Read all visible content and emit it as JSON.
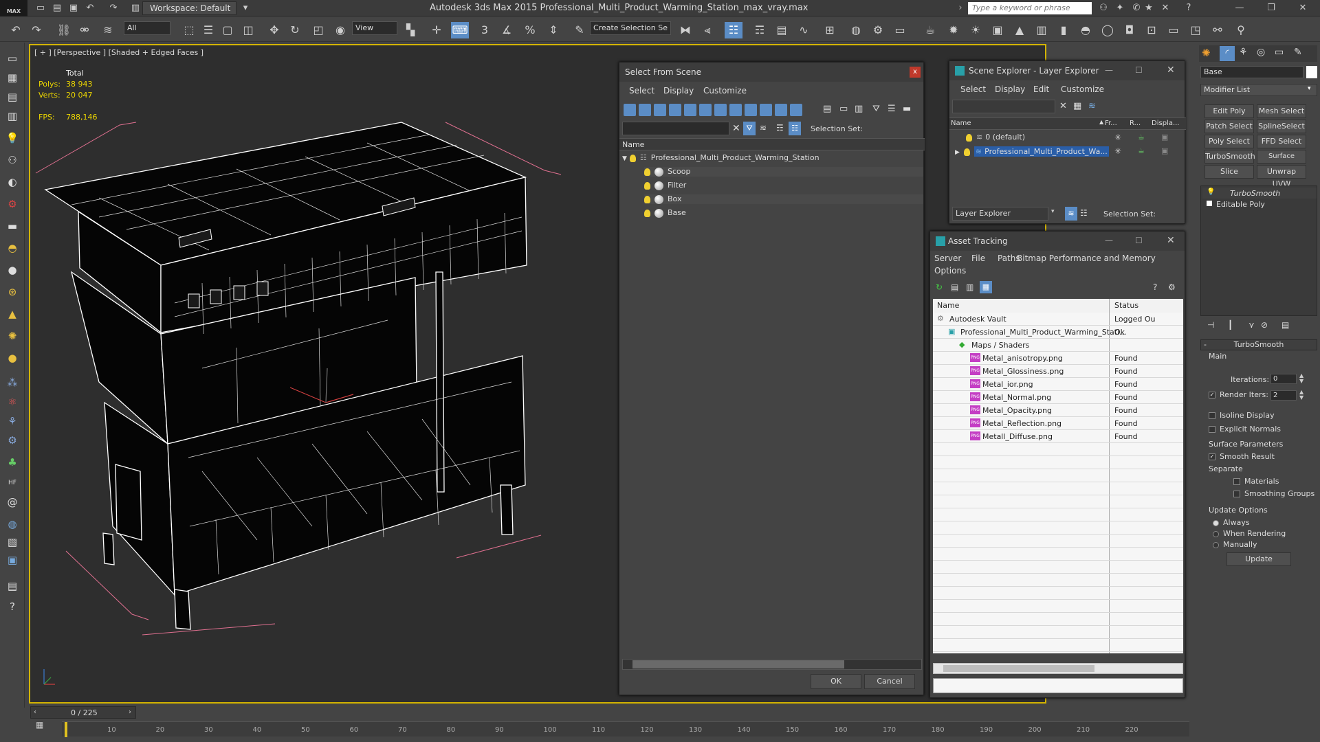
{
  "window": {
    "title": "Autodesk 3ds Max  2015     Professional_Multi_Product_Warming_Station_max_vray.max",
    "logo": "MAX",
    "workspace": "Workspace: Default",
    "search_placeholder": "Type a keyword or phrase"
  },
  "toolbar": {
    "filter_select": "All",
    "refcoord_select": "View",
    "selection_set": "Create Selection Se"
  },
  "viewport": {
    "label": "[ + ] [Perspective ] [Shaded + Edged Faces ]",
    "stats": {
      "total_label": "Total",
      "polys_label": "Polys:",
      "polys_value": "38 943",
      "verts_label": "Verts:",
      "verts_value": "20 047",
      "fps_label": "FPS:",
      "fps_value": "788,146"
    }
  },
  "select_from_scene": {
    "title": "Select From Scene",
    "close": "x",
    "menu": [
      "Select",
      "Display",
      "Customize"
    ],
    "selection_set_label": "Selection Set:",
    "column_name": "Name",
    "root": "Professional_Multi_Product_Warming_Station",
    "children": [
      "Scoop",
      "Filter",
      "Box",
      "Base"
    ],
    "ok": "OK",
    "cancel": "Cancel"
  },
  "scene_explorer": {
    "title": "Scene Explorer - Layer Explorer",
    "menu": [
      "Select",
      "Display",
      "Edit",
      "Customize"
    ],
    "columns": [
      "Name",
      "Fr...",
      "R...",
      "Displa..."
    ],
    "rows": [
      "0 (default)",
      "Professional_Multi_Product_Wa..."
    ],
    "footer_select": "Layer Explorer",
    "selection_set_label": "Selection Set:"
  },
  "asset_tracking": {
    "title": "Asset Tracking",
    "menu": [
      "Server",
      "File",
      "Paths",
      "Bitmap Performance and Memory"
    ],
    "menu2": "Options",
    "columns": [
      "Name",
      "Status"
    ],
    "rows": [
      {
        "name": "Autodesk Vault",
        "status": "Logged Ou"
      },
      {
        "name": "Professional_Multi_Product_Warming_Stati...",
        "status": "Ok"
      },
      {
        "name": "Maps / Shaders",
        "status": ""
      },
      {
        "name": "Metal_anisotropy.png",
        "status": "Found"
      },
      {
        "name": "Metal_Glossiness.png",
        "status": "Found"
      },
      {
        "name": "Metal_ior.png",
        "status": "Found"
      },
      {
        "name": "Metal_Normal.png",
        "status": "Found"
      },
      {
        "name": "Metal_Opacity.png",
        "status": "Found"
      },
      {
        "name": "Metal_Reflection.png",
        "status": "Found"
      },
      {
        "name": "Metall_Diffuse.png",
        "status": "Found"
      }
    ]
  },
  "command_panel": {
    "object_name": "Base",
    "modifier_list": "Modifier List",
    "buttons": [
      "Edit Poly",
      "Mesh Select",
      "Patch Select",
      "SplineSelect",
      "Poly Select",
      "FFD Select",
      "TurboSmooth",
      "Surface Select",
      "Slice",
      "Unwrap UVW"
    ],
    "stack": [
      "TurboSmooth",
      "Editable Poly"
    ],
    "rollout_title": "TurboSmooth",
    "main_label": "Main",
    "iterations_label": "Iterations:",
    "iterations_value": "0",
    "render_iters_label": "Render Iters:",
    "render_iters_value": "2",
    "isoline": "Isoline Display",
    "explicit_normals": "Explicit Normals",
    "surface_params": "Surface Parameters",
    "smooth_result": "Smooth Result",
    "separate": "Separate",
    "materials": "Materials",
    "smoothing_groups": "Smoothing Groups",
    "update_options": "Update Options",
    "always": "Always",
    "when_rendering": "When Rendering",
    "manually": "Manually",
    "update_button": "Update"
  },
  "timeline": {
    "frame": "0 / 225",
    "ticks": [
      "10",
      "20",
      "30",
      "40",
      "50",
      "60",
      "70",
      "80",
      "90",
      "100",
      "110",
      "120",
      "130",
      "140",
      "150",
      "160",
      "170",
      "180",
      "190",
      "200",
      "210",
      "220"
    ]
  }
}
